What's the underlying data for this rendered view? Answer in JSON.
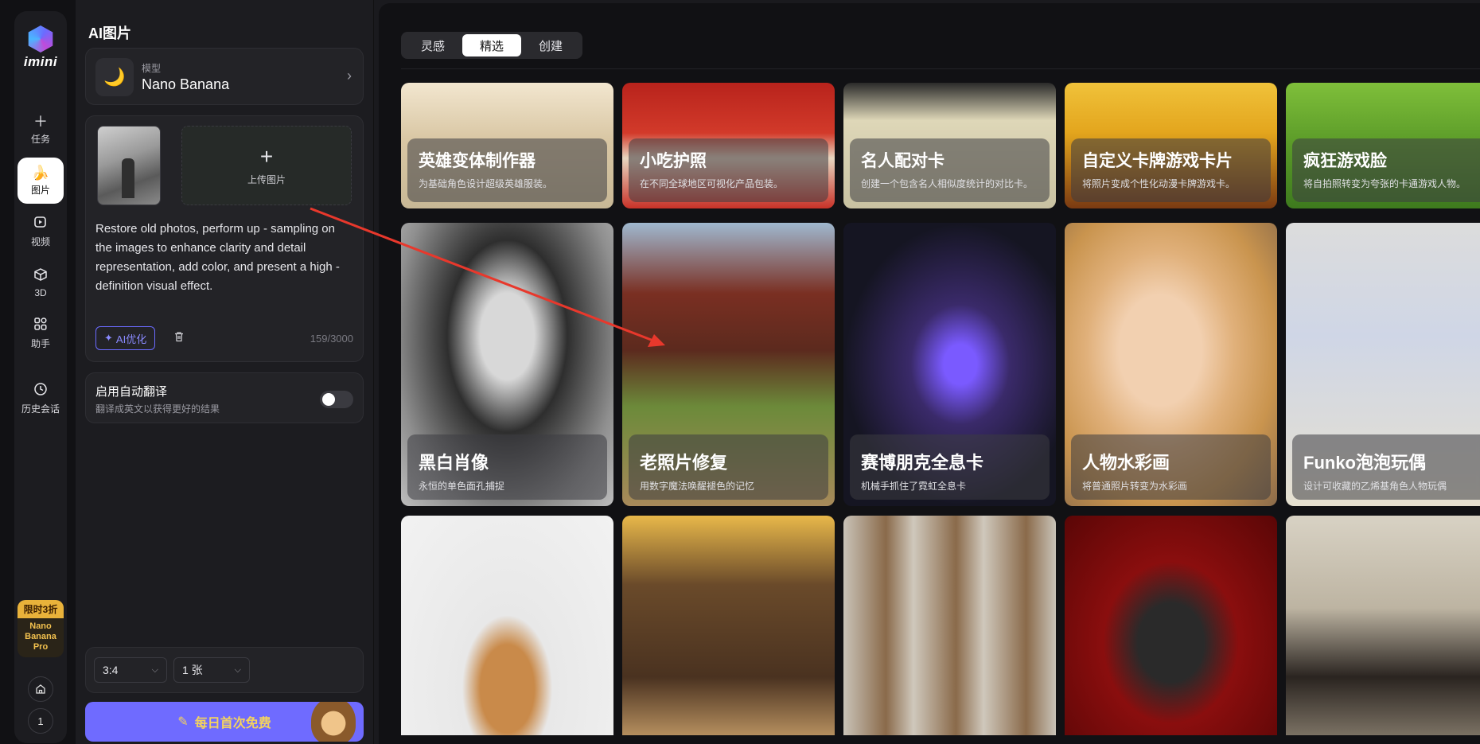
{
  "rail": {
    "logo_text": "imini",
    "nav": [
      {
        "label": "任务",
        "icon": "plus-icon"
      },
      {
        "label": "图片",
        "icon": "banana-icon"
      },
      {
        "label": "视频",
        "icon": "video-icon"
      },
      {
        "label": "3D",
        "icon": "cube-icon"
      },
      {
        "label": "助手",
        "icon": "grid-icon"
      }
    ],
    "history_label": "历史会话",
    "promo": {
      "badge": "限时3折",
      "line1": "Nano",
      "line2": "Banana",
      "line3": "Pro"
    },
    "account_number": "1"
  },
  "panel": {
    "title": "AI图片",
    "model": {
      "label": "模型",
      "value": "Nano Banana"
    },
    "upload_label": "上传图片",
    "prompt": "Restore old photos, perform up - sampling on the images to enhance clarity and detail representation, add color, and present a high - definition visual effect.",
    "ai_button": "AI优化",
    "counter": "159/3000",
    "translate": {
      "title": "启用自动翻译",
      "subtitle": "翻译成英文以获得更好的结果"
    },
    "ratio": "3:4",
    "count": "1 张",
    "generate_label": "每日首次免费"
  },
  "main": {
    "tabs": [
      "灵感",
      "精选",
      "创建"
    ],
    "active_tab": "精选",
    "row1": [
      {
        "title": "英雄变体制作器",
        "desc": "为基础角色设计超级英雄服装。"
      },
      {
        "title": "小吃护照",
        "desc": "在不同全球地区可视化产品包装。"
      },
      {
        "title": "名人配对卡",
        "desc": "创建一个包含名人相似度统计的对比卡。"
      },
      {
        "title": "自定义卡牌游戏卡片",
        "desc": "将照片变成个性化动漫卡牌游戏卡。"
      },
      {
        "title": "疯狂游戏脸",
        "desc": "将自拍照转变为夸张的卡通游戏人物。"
      }
    ],
    "row2": [
      {
        "title": "黑白肖像",
        "desc": "永恒的单色面孔捕捉"
      },
      {
        "title": "老照片修复",
        "desc": "用数字魔法唤醒褪色的记忆"
      },
      {
        "title": "赛博朋克全息卡",
        "desc": "机械手抓住了霓虹全息卡"
      },
      {
        "title": "人物水彩画",
        "desc": "将普通照片转变为水彩画"
      },
      {
        "title": "Funko泡泡玩偶",
        "desc": "设计可收藏的乙烯基角色人物玩偶"
      }
    ]
  }
}
